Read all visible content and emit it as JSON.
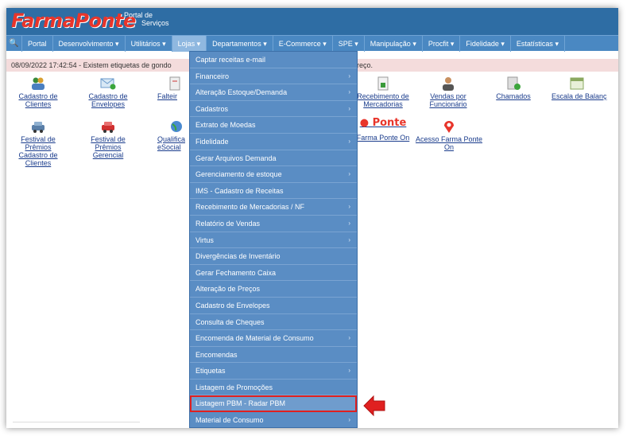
{
  "header": {
    "logo": "FarmaPonte",
    "portal_line1": "Portal de",
    "portal_line2": "Serviços"
  },
  "nav": {
    "items": [
      {
        "label": "Portal"
      },
      {
        "label": "Desenvolvimento ▾"
      },
      {
        "label": "Utilitários ▾"
      },
      {
        "label": "Lojas ▾"
      },
      {
        "label": "Departamentos ▾"
      },
      {
        "label": "E-Commerce ▾"
      },
      {
        "label": "SPE ▾"
      },
      {
        "label": "Manipulação ▾"
      },
      {
        "label": "Procfit ▾"
      },
      {
        "label": "Fidelidade ▾"
      },
      {
        "label": "Estatísticas ▾"
      }
    ],
    "search_icon": "🔍"
  },
  "alert": {
    "text": "08/09/2022 17:42:54 - Existem etiquetas de gondo",
    "text_right": "reço."
  },
  "tiles": {
    "cadastro_clientes": "Cadastro de Clientes",
    "cadastro_envelopes": "Cadastro de Envelopes",
    "falteiro": "Falteir",
    "recebimento": "Recebimento de Mercadorias",
    "vendas_func": "Vendas por Funcionário",
    "chamados": "Chamados",
    "escala": "Escala de Balanç",
    "festival_clientes": "Festival de Prêmios Cadastro de Clientes",
    "festival_gerencial": "Festival de Prêmios Gerencial",
    "qualifica": "Qualifica eSocial",
    "ponte_logo": "Ponte",
    "farma_ponte_on": "Farma Ponte On",
    "acesso_ponte_on": "Acesso Farma Ponte On"
  },
  "menu": {
    "items": [
      {
        "label": "Captar receitas e-mail",
        "sub": ""
      },
      {
        "label": "Financeiro",
        "sub": "›"
      },
      {
        "label": "Alteração Estoque/Demanda",
        "sub": "›"
      },
      {
        "label": "Cadastros",
        "sub": "›"
      },
      {
        "label": "Extrato de Moedas",
        "sub": ""
      },
      {
        "label": "Fidelidade",
        "sub": "›"
      },
      {
        "label": "Gerar Arquivos Demanda",
        "sub": ""
      },
      {
        "label": "Gerenciamento de estoque",
        "sub": "›"
      },
      {
        "label": "IMS - Cadastro de Receitas",
        "sub": ""
      },
      {
        "label": "Recebimento de Mercadorias / NF",
        "sub": "›"
      },
      {
        "label": "Relatório de Vendas",
        "sub": "›"
      },
      {
        "label": "Virtus",
        "sub": "›"
      },
      {
        "label": "Divergências de Inventário",
        "sub": ""
      },
      {
        "label": "Gerar Fechamento Caixa",
        "sub": ""
      },
      {
        "label": "Alteração de Preços",
        "sub": ""
      },
      {
        "label": "Cadastro de Envelopes",
        "sub": ""
      },
      {
        "label": "Consulta de Cheques",
        "sub": ""
      },
      {
        "label": "Encomenda de Material de Consumo",
        "sub": "›"
      },
      {
        "label": "Encomendas",
        "sub": ""
      },
      {
        "label": "Etiquetas",
        "sub": "›"
      },
      {
        "label": "Listagem de Promoções",
        "sub": ""
      },
      {
        "label": "Listagem PBM - Radar PBM",
        "sub": ""
      },
      {
        "label": "Material de Consumo",
        "sub": "›"
      }
    ]
  },
  "colors": {
    "header": "#2e6da4",
    "nav": "#4a88c2",
    "menu": "#5a8dc4",
    "highlight": "#e02020",
    "logo": "#e8352b"
  }
}
